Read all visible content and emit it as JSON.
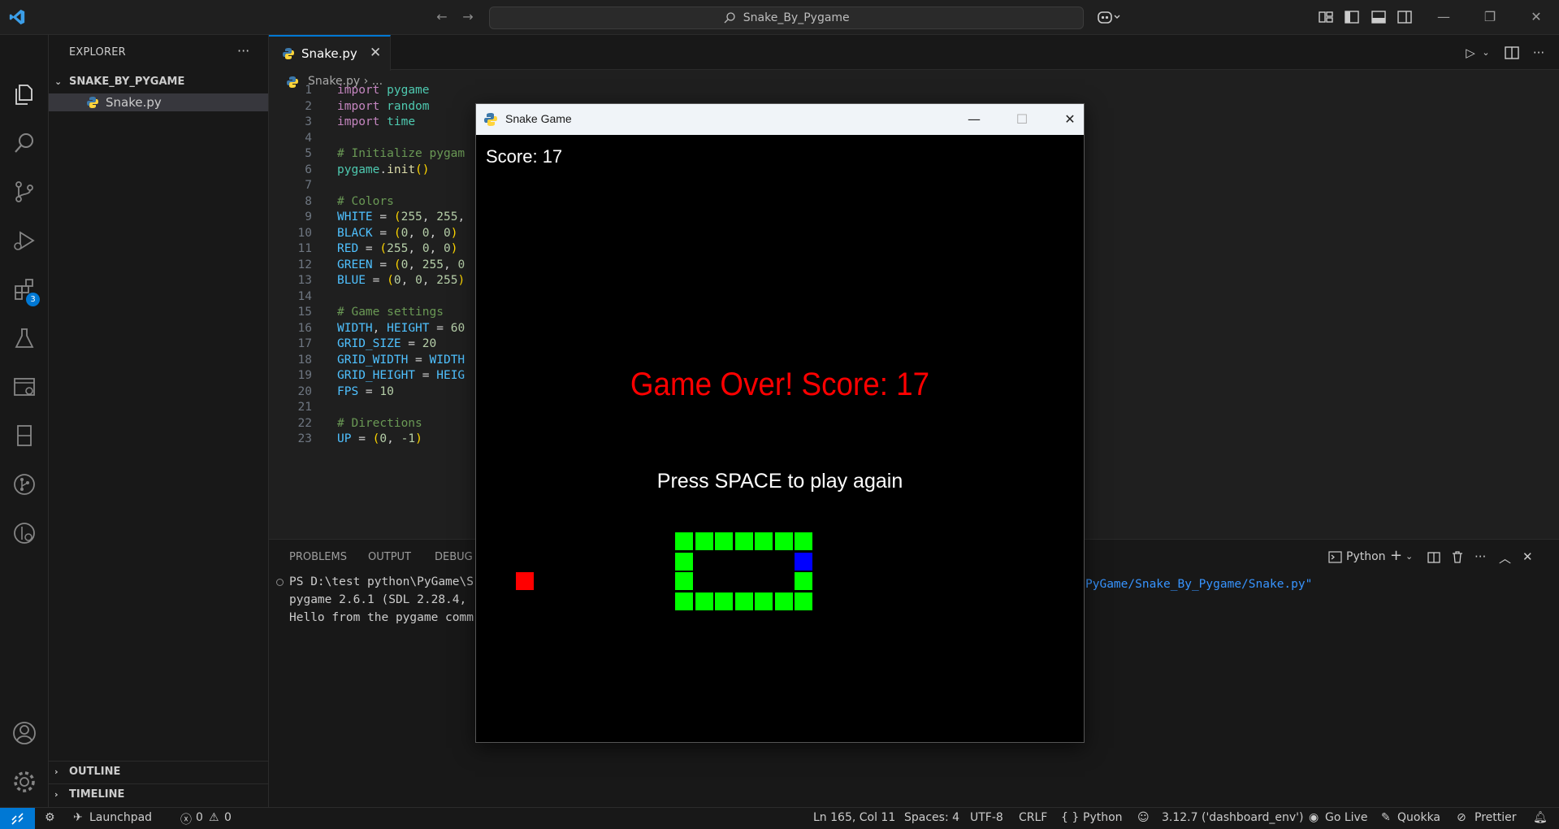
{
  "titlebar": {
    "search_text": "Snake_By_Pygame"
  },
  "activity": {
    "extensions_badge": "3"
  },
  "sidebar": {
    "title": "EXPLORER",
    "folder": "SNAKE_BY_PYGAME",
    "file": "Snake.py",
    "outline": "OUTLINE",
    "timeline": "TIMELINE"
  },
  "editor": {
    "tab_label": "Snake.py",
    "breadcrumb_file": "Snake.py",
    "breadcrumb_rest": "...",
    "lines": [
      {
        "n": "1",
        "t": "import pygame"
      },
      {
        "n": "2",
        "t": "import random"
      },
      {
        "n": "3",
        "t": "import time"
      },
      {
        "n": "4",
        "t": ""
      },
      {
        "n": "5",
        "t": "# Initialize pygam"
      },
      {
        "n": "6",
        "t": "pygame.init()"
      },
      {
        "n": "7",
        "t": ""
      },
      {
        "n": "8",
        "t": "# Colors"
      },
      {
        "n": "9",
        "t": "WHITE = (255, 255,"
      },
      {
        "n": "10",
        "t": "BLACK = (0, 0, 0)"
      },
      {
        "n": "11",
        "t": "RED = (255, 0, 0)"
      },
      {
        "n": "12",
        "t": "GREEN = (0, 255, 0"
      },
      {
        "n": "13",
        "t": "BLUE = (0, 0, 255)"
      },
      {
        "n": "14",
        "t": ""
      },
      {
        "n": "15",
        "t": "# Game settings"
      },
      {
        "n": "16",
        "t": "WIDTH, HEIGHT = 60"
      },
      {
        "n": "17",
        "t": "GRID_SIZE = 20"
      },
      {
        "n": "18",
        "t": "GRID_WIDTH = WIDTH"
      },
      {
        "n": "19",
        "t": "GRID_HEIGHT = HEIG"
      },
      {
        "n": "20",
        "t": "FPS = 10"
      },
      {
        "n": "21",
        "t": ""
      },
      {
        "n": "22",
        "t": "# Directions"
      },
      {
        "n": "23",
        "t": "UP = (0, -1)"
      }
    ]
  },
  "panel": {
    "tabs": [
      "PROBLEMS",
      "OUTPUT",
      "DEBUG C"
    ],
    "terminal_name": "Python",
    "terminal_lines": [
      "PS D:\\test python\\PyGame\\S",
      "pygame 2.6.1 (SDL 2.28.4,",
      "Hello from the pygame comm"
    ],
    "terminal_path": "PyGame/Snake_By_Pygame/Snake.py\""
  },
  "statusbar": {
    "launchpad": "Launchpad",
    "errors": "0",
    "warnings": "0",
    "position": "Ln 165, Col 11",
    "spaces": "Spaces: 4",
    "encoding": "UTF-8",
    "eol": "CRLF",
    "language": "Python",
    "interpreter": "3.12.7 ('dashboard_env')",
    "golive": "Go Live",
    "quokka": "Quokka",
    "prettier": "Prettier"
  },
  "game": {
    "window_title": "Snake Game",
    "score": "Score: 17",
    "game_over": "Game Over! Score: 17",
    "prompt": "Press SPACE to play again",
    "colors": {
      "snake": "#00ff00",
      "head": "#0000ff",
      "food": "#ff0000"
    },
    "snake_cells": [
      [
        0,
        0
      ],
      [
        1,
        0
      ],
      [
        2,
        0
      ],
      [
        3,
        0
      ],
      [
        4,
        0
      ],
      [
        5,
        0
      ],
      [
        6,
        0
      ],
      [
        0,
        1
      ],
      [
        6,
        1
      ],
      [
        0,
        2
      ],
      [
        6,
        2
      ],
      [
        0,
        3
      ],
      [
        1,
        3
      ],
      [
        2,
        3
      ],
      [
        3,
        3
      ],
      [
        4,
        3
      ],
      [
        5,
        3
      ],
      [
        6,
        3
      ]
    ],
    "head_cell": [
      6,
      1
    ],
    "food_cell": [
      -8,
      2
    ]
  }
}
